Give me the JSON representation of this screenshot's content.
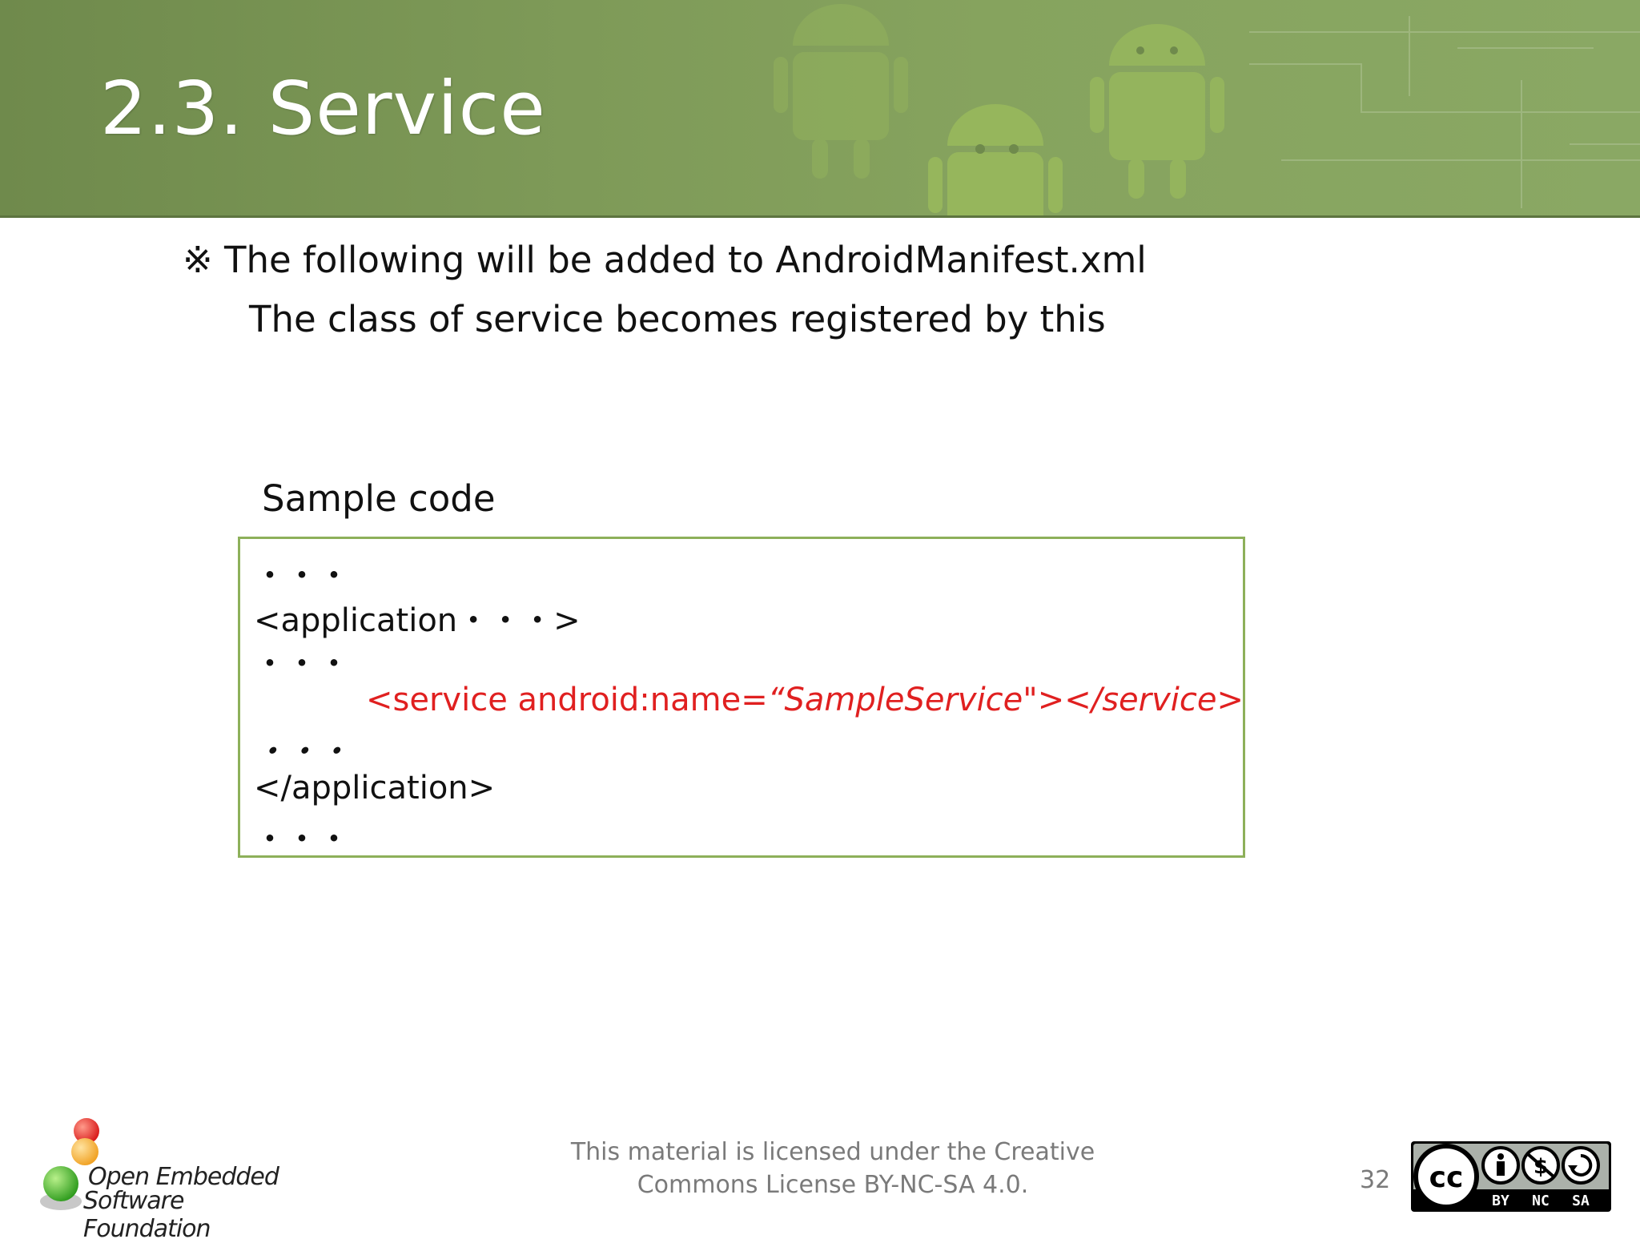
{
  "slide": {
    "title": "2.3. Service",
    "note_mark": "※",
    "note_line1": "The following will be added to AndroidManifest.xml",
    "note_line2": "The class of service becomes registered by this",
    "sample_label": "Sample code"
  },
  "code": {
    "line1": "・・・",
    "line2": "<application・・・>",
    "line3": "・・・",
    "line4_prefix": "<service android:name=",
    "line4_italic": "“SampleService",
    "line4_mid": "\">",
    "line4_tail": "</service>",
    "line5": "・・・",
    "line6": "</application>",
    "line7": "・・・",
    "highlight_color": "#e02020",
    "border_color": "#8db05a"
  },
  "footer": {
    "logo_line1": "Open Embedded",
    "logo_line2": "Software Foundation",
    "license_line1": "This material is licensed under the Creative",
    "license_line2": "Commons License BY-NC-SA 4.0.",
    "page_number": "32",
    "cc_badge_labels": [
      "BY",
      "NC",
      "SA"
    ]
  },
  "colors": {
    "header_green": "#7e9a58",
    "title_text": "#ffffff"
  }
}
